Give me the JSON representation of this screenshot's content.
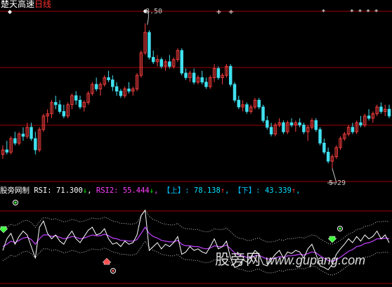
{
  "title": {
    "name": "楚天高速",
    "period": "日线"
  },
  "price_panel": {
    "high_label": "8.50",
    "low_label": "5.29"
  },
  "rsi_bar": {
    "indicator": "股旁网制",
    "rsi1_label": "RSI:",
    "rsi1_value": "71.300",
    "rsi1_arrow": "↓",
    "rsi2_label": "RSI2:",
    "rsi2_value": "55.444",
    "rsi2_arrow": "↓",
    "up_label": "【上】:",
    "up_value": "78.138",
    "up_arrow": "↑",
    "down_label": "【下】:",
    "down_value": "43.339",
    "down_arrow": "↑",
    "sep": ","
  },
  "watermark": {
    "cn": "股旁网",
    "url": "www.gupang.com"
  },
  "colors": {
    "background": "#000000",
    "up_candle": "#ff4040",
    "down_candle": "#40e0f0",
    "grid": "#a00000",
    "rsi1": "#ffffff",
    "rsi2": "#c040ff",
    "band": "#c8c8c8",
    "signal_buy": "#40ff40",
    "signal_sell": "#ff5050"
  },
  "chart_data": {
    "type": "candlestick",
    "title": "楚天高速 日线",
    "price_high": 8.5,
    "price_low": 5.29,
    "candles_ohlc": [
      [
        5.6,
        5.8,
        5.5,
        5.7
      ],
      [
        5.7,
        5.9,
        5.6,
        5.65
      ],
      [
        5.65,
        6.0,
        5.6,
        5.95
      ],
      [
        5.95,
        6.1,
        5.8,
        5.85
      ],
      [
        5.85,
        6.1,
        5.8,
        6.05
      ],
      [
        6.05,
        6.2,
        5.9,
        6.0
      ],
      [
        6.0,
        6.3,
        5.95,
        6.2
      ],
      [
        6.2,
        6.3,
        5.9,
        5.95
      ],
      [
        5.95,
        6.1,
        5.6,
        5.7
      ],
      [
        5.7,
        6.2,
        5.65,
        6.15
      ],
      [
        6.15,
        6.5,
        6.1,
        6.45
      ],
      [
        6.45,
        6.6,
        6.3,
        6.5
      ],
      [
        6.5,
        6.8,
        6.4,
        6.75
      ],
      [
        6.75,
        6.9,
        6.6,
        6.7
      ],
      [
        6.7,
        6.8,
        6.5,
        6.55
      ],
      [
        6.55,
        6.7,
        6.4,
        6.45
      ],
      [
        6.45,
        6.75,
        6.4,
        6.7
      ],
      [
        6.7,
        6.95,
        6.6,
        6.9
      ],
      [
        6.9,
        7.0,
        6.7,
        6.8
      ],
      [
        6.8,
        6.9,
        6.6,
        6.65
      ],
      [
        6.65,
        6.8,
        6.55,
        6.75
      ],
      [
        6.75,
        7.0,
        6.7,
        6.95
      ],
      [
        6.95,
        7.2,
        6.9,
        7.15
      ],
      [
        7.15,
        7.3,
        7.0,
        7.05
      ],
      [
        7.05,
        7.2,
        6.9,
        7.15
      ],
      [
        7.15,
        7.35,
        7.1,
        7.3
      ],
      [
        7.3,
        7.45,
        7.2,
        7.25
      ],
      [
        7.25,
        7.35,
        7.0,
        7.1
      ],
      [
        7.1,
        7.2,
        6.9,
        7.0
      ],
      [
        7.0,
        7.05,
        6.85,
        6.9
      ],
      [
        6.9,
        7.1,
        6.85,
        7.05
      ],
      [
        7.05,
        7.2,
        6.95,
        7.0
      ],
      [
        7.0,
        7.1,
        6.9,
        7.05
      ],
      [
        7.05,
        7.4,
        7.0,
        7.35
      ],
      [
        7.35,
        7.9,
        7.3,
        7.85
      ],
      [
        7.85,
        8.5,
        7.8,
        8.3
      ],
      [
        8.3,
        8.35,
        7.7,
        7.75
      ],
      [
        7.75,
        7.9,
        7.6,
        7.65
      ],
      [
        7.65,
        7.8,
        7.55,
        7.7
      ],
      [
        7.7,
        7.75,
        7.5,
        7.55
      ],
      [
        7.55,
        7.7,
        7.45,
        7.65
      ],
      [
        7.65,
        7.8,
        7.5,
        7.55
      ],
      [
        7.55,
        7.75,
        7.5,
        7.7
      ],
      [
        7.7,
        7.95,
        7.65,
        7.9
      ],
      [
        7.9,
        7.95,
        7.35,
        7.4
      ],
      [
        7.4,
        7.5,
        7.25,
        7.3
      ],
      [
        7.3,
        7.45,
        7.2,
        7.4
      ],
      [
        7.4,
        7.5,
        7.15,
        7.2
      ],
      [
        7.2,
        7.35,
        7.15,
        7.3
      ],
      [
        7.3,
        7.45,
        7.15,
        7.2
      ],
      [
        7.2,
        7.3,
        7.05,
        7.1
      ],
      [
        7.1,
        7.35,
        7.05,
        7.3
      ],
      [
        7.3,
        7.6,
        7.2,
        7.5
      ],
      [
        7.5,
        7.55,
        7.25,
        7.3
      ],
      [
        7.3,
        7.4,
        7.15,
        7.35
      ],
      [
        7.35,
        7.6,
        7.3,
        7.55
      ],
      [
        7.55,
        7.6,
        7.1,
        7.15
      ],
      [
        7.15,
        7.2,
        6.75,
        6.8
      ],
      [
        6.8,
        6.9,
        6.6,
        6.65
      ],
      [
        6.65,
        6.8,
        6.55,
        6.7
      ],
      [
        6.7,
        6.75,
        6.5,
        6.55
      ],
      [
        6.55,
        6.7,
        6.5,
        6.65
      ],
      [
        6.65,
        6.85,
        6.6,
        6.8
      ],
      [
        6.8,
        6.85,
        6.6,
        6.65
      ],
      [
        6.65,
        6.7,
        6.3,
        6.35
      ],
      [
        6.35,
        6.45,
        6.15,
        6.2
      ],
      [
        6.2,
        6.3,
        6.0,
        6.05
      ],
      [
        6.05,
        6.3,
        6.0,
        6.25
      ],
      [
        6.25,
        6.4,
        6.2,
        6.3
      ],
      [
        6.3,
        6.35,
        6.05,
        6.1
      ],
      [
        6.1,
        6.35,
        6.05,
        6.3
      ],
      [
        6.3,
        6.4,
        6.2,
        6.25
      ],
      [
        6.25,
        6.35,
        6.1,
        6.3
      ],
      [
        6.3,
        6.4,
        6.2,
        6.25
      ],
      [
        6.25,
        6.3,
        6.05,
        6.1
      ],
      [
        6.1,
        6.25,
        5.9,
        6.2
      ],
      [
        6.2,
        6.4,
        6.15,
        6.35
      ],
      [
        6.35,
        6.4,
        6.1,
        6.15
      ],
      [
        6.15,
        6.2,
        5.8,
        5.85
      ],
      [
        5.85,
        5.95,
        5.6,
        5.65
      ],
      [
        5.65,
        5.75,
        5.4,
        5.45
      ],
      [
        5.45,
        5.6,
        5.29,
        5.55
      ],
      [
        5.55,
        5.8,
        5.5,
        5.75
      ],
      [
        5.75,
        6.0,
        5.7,
        5.95
      ],
      [
        5.95,
        6.1,
        5.9,
        6.05
      ],
      [
        6.05,
        6.25,
        6.0,
        6.2
      ],
      [
        6.2,
        6.3,
        6.05,
        6.1
      ],
      [
        6.1,
        6.35,
        6.05,
        6.3
      ],
      [
        6.3,
        6.45,
        6.2,
        6.25
      ],
      [
        6.25,
        6.5,
        6.2,
        6.45
      ],
      [
        6.45,
        6.6,
        6.35,
        6.4
      ],
      [
        6.4,
        6.55,
        6.3,
        6.5
      ],
      [
        6.5,
        6.7,
        6.45,
        6.65
      ],
      [
        6.65,
        6.75,
        6.5,
        6.55
      ],
      [
        6.55,
        6.7,
        6.45,
        6.6
      ],
      [
        6.6,
        6.7,
        6.4,
        6.45
      ]
    ],
    "marker_indices": [
      35,
      53,
      56,
      79,
      86,
      88,
      90,
      92
    ],
    "rsi1": [
      40,
      55,
      62,
      48,
      58,
      65,
      60,
      45,
      30,
      70,
      78,
      62,
      55,
      60,
      52,
      48,
      58,
      65,
      55,
      50,
      58,
      66,
      70,
      60,
      62,
      68,
      55,
      48,
      50,
      45,
      52,
      48,
      50,
      60,
      85,
      92,
      40,
      45,
      50,
      42,
      48,
      45,
      50,
      58,
      35,
      38,
      45,
      40,
      42,
      38,
      36,
      45,
      55,
      42,
      45,
      52,
      30,
      18,
      20,
      28,
      25,
      32,
      40,
      35,
      22,
      20,
      28,
      35,
      40,
      30,
      38,
      36,
      40,
      38,
      30,
      42,
      48,
      35,
      20,
      18,
      15,
      22,
      35,
      42,
      48,
      55,
      50,
      58,
      52,
      60,
      55,
      58,
      65,
      55,
      60,
      50
    ],
    "rsi2": [
      45,
      48,
      52,
      50,
      53,
      56,
      57,
      54,
      48,
      55,
      60,
      60,
      58,
      59,
      57,
      55,
      56,
      58,
      57,
      55,
      56,
      58,
      60,
      59,
      59,
      61,
      59,
      56,
      55,
      53,
      53,
      52,
      52,
      54,
      62,
      70,
      62,
      58,
      56,
      53,
      52,
      51,
      51,
      53,
      48,
      46,
      46,
      45,
      45,
      43,
      42,
      43,
      46,
      45,
      45,
      47,
      42,
      37,
      34,
      33,
      31,
      31,
      33,
      34,
      31,
      29,
      29,
      30,
      32,
      31,
      33,
      33,
      34,
      35,
      34,
      36,
      38,
      37,
      33,
      30,
      27,
      26,
      28,
      31,
      35,
      39,
      41,
      45,
      46,
      49,
      50,
      52,
      55,
      55,
      56,
      55
    ],
    "ylim_rsi": [
      0,
      100
    ]
  }
}
